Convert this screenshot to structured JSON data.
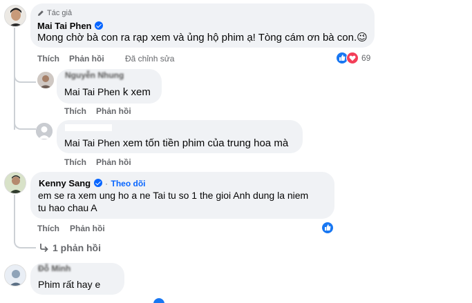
{
  "colors": {
    "link": "#0866ff",
    "muted": "#65676b",
    "bubble": "#f0f2f5",
    "like_blue": "#1877f2",
    "love_red": "#f33e58"
  },
  "comments": [
    {
      "author_badge": "Tác giả",
      "author": "Mai Tai Phen",
      "verified": true,
      "text": "Mong chờ bà con ra rạp xem và ủng hộ phim ạ! Tòng cám ơn bà con.",
      "emoji": "😉",
      "like_label": "Thích",
      "reply_label": "Phản hồi",
      "edited_label": "Đã chỉnh sửa",
      "reaction_icons": [
        "like-icon",
        "love-icon"
      ],
      "reaction_count": "69",
      "replies": [
        {
          "author": "Nguyễn Nhung",
          "mention": "Mai Tai Phen",
          "text": "k xem",
          "like_label": "Thích",
          "reply_label": "Phản hồi"
        },
        {
          "author": "",
          "mention": "Mai Tai Phen",
          "text": "xem tốn tiền phim của trung hoa mà",
          "like_label": "Thích",
          "reply_label": "Phản hồi"
        }
      ]
    },
    {
      "author": "Kenny Sang",
      "verified": true,
      "follow_label": "Theo dõi",
      "text_line1": "em se ra xem ung ho a ne Tai tu so 1 the gioi Anh dung la niem",
      "text_line2": "tu hao chau A",
      "like_label": "Thích",
      "reply_label": "Phản hồi",
      "reaction_icons": [
        "like-icon"
      ],
      "view_replies_label": "1 phản hồi"
    },
    {
      "author": "Đỗ Minh",
      "text": "Phim rất hay e"
    }
  ]
}
